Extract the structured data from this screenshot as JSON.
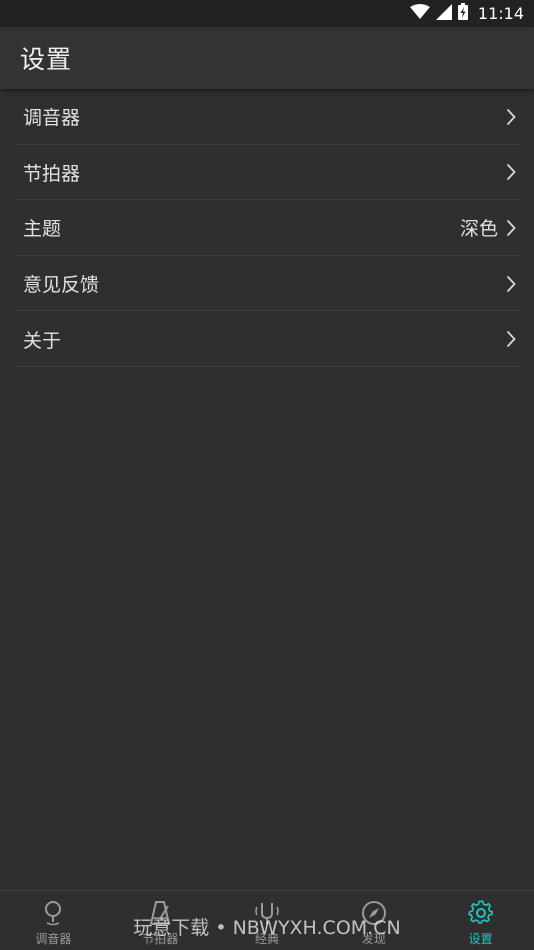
{
  "status_bar": {
    "time": "11:14",
    "icons": [
      "wifi-icon",
      "signal-icon",
      "battery-icon"
    ]
  },
  "app_bar": {
    "title": "设置"
  },
  "settings": [
    {
      "label": "调音器",
      "value": ""
    },
    {
      "label": "节拍器",
      "value": ""
    },
    {
      "label": "主题",
      "value": "深色"
    },
    {
      "label": "意见反馈",
      "value": ""
    },
    {
      "label": "关于",
      "value": ""
    }
  ],
  "bottom_nav": [
    {
      "label": "调音器",
      "icon": "tuner-icon",
      "active": false
    },
    {
      "label": "节拍器",
      "icon": "metronome-icon",
      "active": false
    },
    {
      "label": "经典",
      "icon": "tuning-fork-icon",
      "active": false
    },
    {
      "label": "发现",
      "icon": "compass-icon",
      "active": false
    },
    {
      "label": "设置",
      "icon": "gear-icon",
      "active": true
    }
  ],
  "watermark": "玩意下载 • NBWYXH.COM.CN",
  "colors": {
    "accent": "#22c5c0",
    "background": "#2f2f2f",
    "app_bar": "#333333",
    "status_bar": "#222222"
  }
}
